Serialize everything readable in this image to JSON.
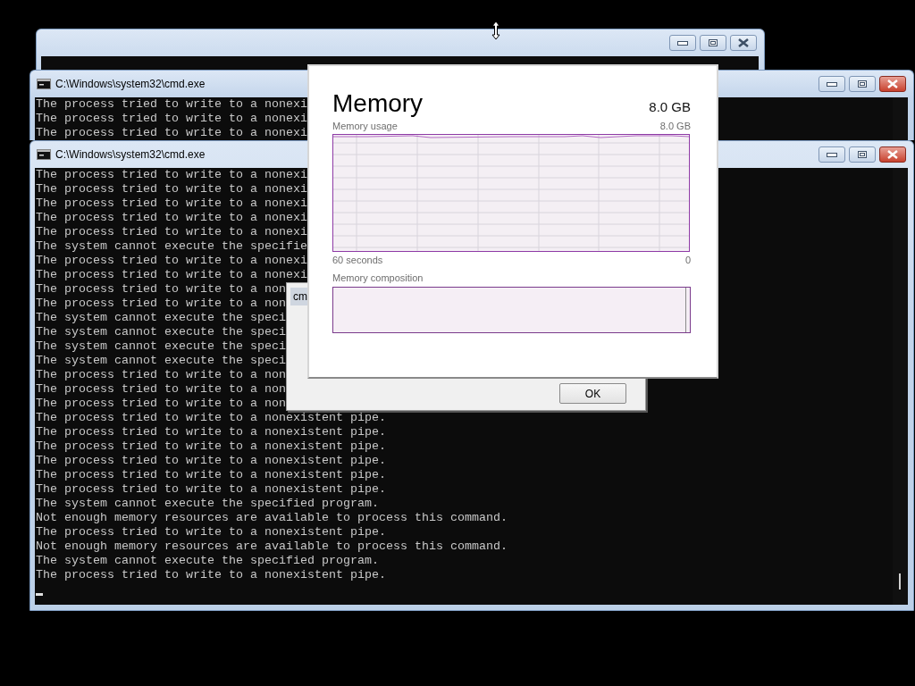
{
  "console_windows": [
    {
      "title": "C:\\Windows\\system32\\cmd.exe",
      "lines": [
        "The process tried to write to a nonexi",
        "The process tried to write to a nonexi",
        "The process tried to write to a nonexi"
      ]
    },
    {
      "title": "C:\\Windows\\system32\\cmd.exe",
      "lines": [
        "The process tried to write to a nonexi",
        "The process tried to write to a nonexi",
        "The process tried to write to a nonexi",
        "The process tried to write to a nonexi",
        "The process tried to write to a nonexi",
        "The system cannot execute the specifie",
        "The process tried to write to a nonexi",
        "The process tried to write to a nonexi",
        "The process tried to write to a non",
        "The process tried to write to a non",
        "The system cannot execute the speci",
        "The system cannot execute the speci",
        "The system cannot execute the speci",
        "The system cannot execute the speci",
        "The process tried to write to a non",
        "The process tried to write to a non",
        "The process tried to write to a non",
        "The process tried to write to a nonexistent pipe.",
        "The process tried to write to a nonexistent pipe.",
        "The process tried to write to a nonexistent pipe.",
        "The process tried to write to a nonexistent pipe.",
        "The process tried to write to a nonexistent pipe.",
        "The process tried to write to a nonexistent pipe.",
        "The system cannot execute the specified program.",
        "Not enough memory resources are available to process this command.",
        "The process tried to write to a nonexistent pipe.",
        "Not enough memory resources are available to process this command.",
        "The system cannot execute the specified program.",
        "The process tried to write to a nonexistent pipe."
      ]
    }
  ],
  "dialog": {
    "tab_text": "cm",
    "button": "OK"
  },
  "memory_panel": {
    "title": "Memory",
    "total": "8.0 GB",
    "usage_label": "Memory usage",
    "usage_max": "8.0 GB",
    "time_start": "60 seconds",
    "time_end": "0",
    "composition_label": "Memory composition"
  }
}
